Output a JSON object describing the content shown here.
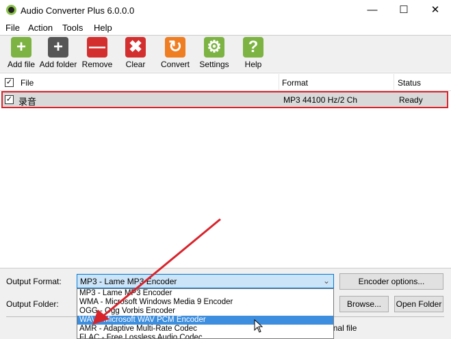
{
  "window": {
    "title": "Audio Converter Plus 6.0.0.0",
    "minimize": "—",
    "maximize": "☐",
    "close": "✕"
  },
  "menu": [
    "File",
    "Action",
    "Tools",
    "Help"
  ],
  "toolbar": [
    {
      "label": "Add file",
      "icon": "plus-icon",
      "color": "#7cb342",
      "glyph": "+"
    },
    {
      "label": "Add folder",
      "icon": "folder-add-icon",
      "color": "#555555",
      "glyph": "+"
    },
    {
      "label": "Remove",
      "icon": "minus-icon",
      "color": "#d32f2f",
      "glyph": "—"
    },
    {
      "label": "Clear",
      "icon": "x-icon",
      "color": "#d32f2f",
      "glyph": "✖"
    },
    {
      "label": "Convert",
      "icon": "convert-icon",
      "color": "#ef7d22",
      "glyph": "↻"
    },
    {
      "label": "Settings",
      "icon": "gear-icon",
      "color": "#7cb342",
      "glyph": "⚙"
    },
    {
      "label": "Help",
      "icon": "question-icon",
      "color": "#7cb342",
      "glyph": "?"
    }
  ],
  "columns": {
    "file": "File",
    "format": "Format",
    "status": "Status"
  },
  "rows": [
    {
      "file": "录音",
      "format": "MP3 44100 Hz/2 Ch",
      "status": "Ready",
      "checked": "✓"
    }
  ],
  "check_mark": "✓",
  "bottom": {
    "output_format_label": "Output Format:",
    "output_format_value": "MP3 - Lame MP3 Encoder",
    "encoder_options": "Encoder options...",
    "output_folder_label": "Output Folder:",
    "browse": "Browse...",
    "open_folder": "Open Folder",
    "same_folder": "Same folder as original file",
    "options": [
      "MP3 - Lame MP3 Encoder",
      "WMA - Microsoft Windows Media 9 Encoder",
      "OGG - Ogg Vorbis Encoder",
      "WAV - Microsoft WAV PCM Encoder",
      "AMR - Adaptive Multi-Rate Codec",
      "FLAC - Free Lossless Audio Codec"
    ]
  }
}
